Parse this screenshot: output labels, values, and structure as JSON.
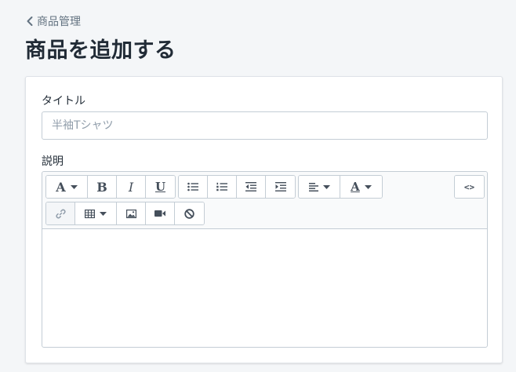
{
  "breadcrumb": {
    "label": "商品管理"
  },
  "page": {
    "title": "商品を追加する"
  },
  "form": {
    "title_label": "タイトル",
    "title_placeholder": "半袖Tシャツ",
    "title_value": "",
    "description_label": "説明"
  },
  "toolbar": {
    "font": "A",
    "bold": "B",
    "italic": "I",
    "underline": "U",
    "text_color": "A",
    "source": "<>"
  },
  "editor": {
    "content": ""
  },
  "colors": {
    "accent": "#5c6ac4",
    "text": "#212b36",
    "muted": "#637381",
    "border": "#c4cdd5"
  }
}
